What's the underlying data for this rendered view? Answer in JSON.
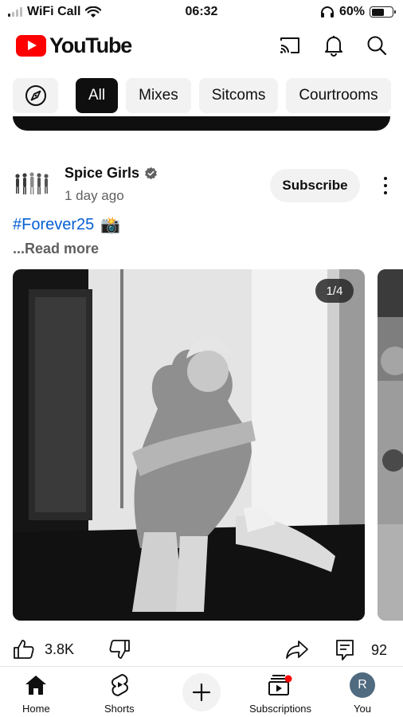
{
  "status_bar": {
    "carrier": "WiFi Call",
    "time": "06:32",
    "battery": "60%",
    "battery_level": 0.6
  },
  "header": {
    "logo_text": "YouTube",
    "icons": [
      "cast-icon",
      "notifications-bell-icon",
      "search-icon"
    ]
  },
  "chips": {
    "explore_icon": "compass-icon",
    "items": [
      "All",
      "Mixes",
      "Sitcoms",
      "Courtrooms"
    ],
    "selected": "All"
  },
  "post": {
    "channel_name": "Spice Girls",
    "verified": true,
    "time": "1 day ago",
    "subscribe_label": "Subscribe",
    "hashtag": "#Forever25",
    "hashtag_emoji": "📸",
    "read_more": "...Read more",
    "image_counter": "1/4",
    "likes": "3.8K",
    "comments": "92"
  },
  "bottom_nav": {
    "items": [
      {
        "label": "Home",
        "icon": "home-icon"
      },
      {
        "label": "Shorts",
        "icon": "shorts-icon"
      },
      {
        "label": "",
        "icon": "create-icon"
      },
      {
        "label": "Subscriptions",
        "icon": "subscriptions-icon"
      },
      {
        "label": "You",
        "icon": "avatar"
      }
    ],
    "avatar_initial": "R"
  },
  "colors": {
    "brand_red": "#ff0000",
    "link_blue": "#065fd4",
    "chip_bg": "#f2f2f2",
    "active_chip": "#0f0f0f",
    "avatar_bg": "#506a7f"
  }
}
